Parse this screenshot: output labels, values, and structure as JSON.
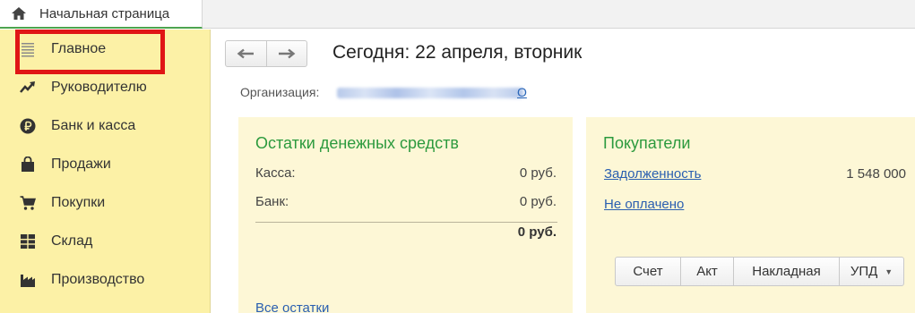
{
  "tabs": {
    "home_label": "Начальная страница"
  },
  "sidebar": {
    "items": [
      {
        "label": "Главное",
        "icon": "list-icon"
      },
      {
        "label": "Руководителю",
        "icon": "trend-up-icon"
      },
      {
        "label": "Банк и касса",
        "icon": "ruble-icon"
      },
      {
        "label": "Продажи",
        "icon": "shopping-bag-icon"
      },
      {
        "label": "Покупки",
        "icon": "cart-icon"
      },
      {
        "label": "Склад",
        "icon": "warehouse-grid-icon"
      },
      {
        "label": "Производство",
        "icon": "factory-icon"
      }
    ]
  },
  "header": {
    "title": "Сегодня: 22 апреля, вторник"
  },
  "organization": {
    "label": "Организация:",
    "value_visible_tail": "О"
  },
  "cash_panel": {
    "title": "Остатки денежных средств",
    "rows": [
      {
        "label": "Касса:",
        "value": "0 руб."
      },
      {
        "label": "Банк:",
        "value": "0 руб."
      }
    ],
    "total": "0 руб.",
    "all_link": "Все остатки"
  },
  "buyers_panel": {
    "title": "Покупатели",
    "debt_label": "Задолженность",
    "debt_value": "1 548 000",
    "unpaid_label": "Не оплачено",
    "doc_buttons": [
      "Счет",
      "Акт",
      "Накладная",
      "УПД"
    ]
  },
  "colors": {
    "sidebar_bg": "#fcf1a6",
    "panel_bg": "#fdf7d6",
    "title_green": "#2c9a3e",
    "link_blue": "#2a5fb0",
    "highlight_red": "#e01515"
  }
}
